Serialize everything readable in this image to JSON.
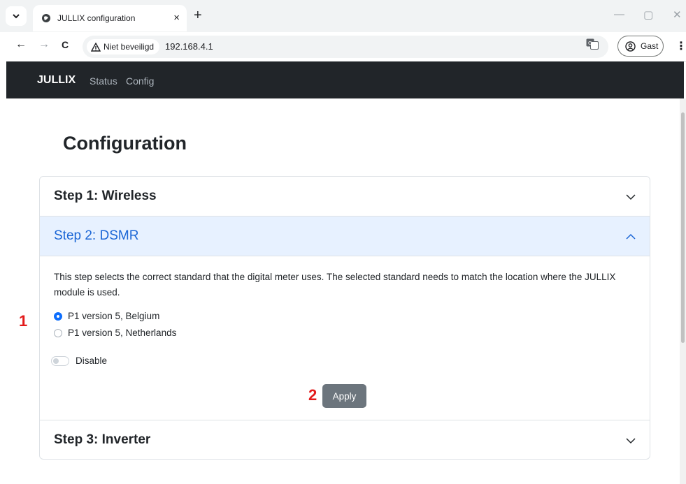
{
  "browser": {
    "tab_title": "JULLIX configuration",
    "tab_close": "×",
    "new_tab": "+",
    "security_label": "Niet beveiligd",
    "url": "192.168.4.1",
    "profile_label": "Gast",
    "window_controls": {
      "minimize": "—",
      "maximize": "▢",
      "close": "✕"
    },
    "nav": {
      "back": "←",
      "forward": "→",
      "reload": "C",
      "menu": "⋮"
    }
  },
  "navbar": {
    "brand": "JULLIX",
    "links": [
      "Status",
      "Config"
    ]
  },
  "page": {
    "title": "Configuration",
    "steps": [
      {
        "title": "Step 1: Wireless",
        "expanded": false
      },
      {
        "title": "Step 2: DSMR",
        "expanded": true
      },
      {
        "title": "Step 3: Inverter",
        "expanded": false
      }
    ],
    "dsmr": {
      "description": "This step selects the correct standard that the digital meter uses. The selected standard needs to match the location where the JULLIX module is used.",
      "options": [
        {
          "label": "P1 version 5, Belgium",
          "checked": true
        },
        {
          "label": "P1 version 5, Netherlands",
          "checked": false
        }
      ],
      "switch_label": "Disable",
      "apply_label": "Apply"
    }
  },
  "annotations": [
    "1",
    "2"
  ],
  "colors": {
    "accent": "#0d6efd",
    "navbar": "#212529",
    "annotation": "#e31b1b",
    "active_header_bg": "#e7f1ff"
  }
}
